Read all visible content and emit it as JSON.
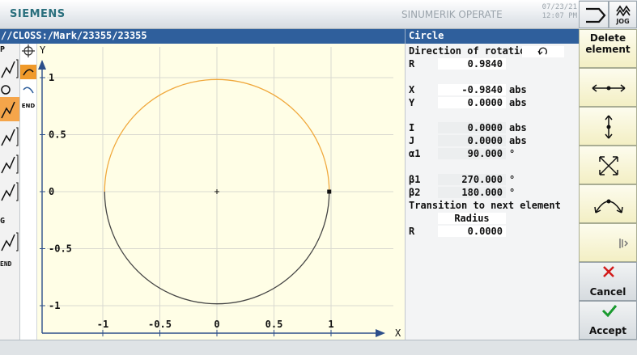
{
  "header": {
    "brand": "SIEMENS",
    "app": "SINUMERIK OPERATE",
    "date": "07/23/21",
    "time": "12:07 PM",
    "jog_label": "JOG"
  },
  "path_title": "//CLOSS:/Mark/23355/23355",
  "form": {
    "title": "Circle",
    "direction_label": "Direction of rotation",
    "r_label": "R",
    "r_value": "0.9840",
    "x_label": "X",
    "x_value": "-0.9840",
    "x_unit": "abs",
    "y_label": "Y",
    "y_value": "0.0000",
    "y_unit": "abs",
    "i_label": "I",
    "i_value": "0.0000",
    "i_unit": "abs",
    "j_label": "J",
    "j_value": "0.0000",
    "j_unit": "abs",
    "a1_label": "α1",
    "a1_value": "90.000",
    "a1_unit": "°",
    "b1_label": "β1",
    "b1_value": "270.000",
    "b1_unit": "°",
    "b2_label": "β2",
    "b2_value": "180.000",
    "b2_unit": "°",
    "transition_label": "Transition to next element",
    "transition_type": "Radius",
    "r2_label": "R",
    "r2_value": "0.0000"
  },
  "tree": {
    "labels": [
      "P",
      "G",
      "END"
    ]
  },
  "tools": {
    "end_label": "END"
  },
  "graph": {
    "y_axis_label": "Y",
    "x_axis_label": "X",
    "x_ticks": [
      "-1",
      "-0.5",
      "0",
      "0.5",
      "1"
    ],
    "y_ticks": [
      "1",
      "0.5",
      "0",
      "-0.5",
      "-1"
    ],
    "x_tick_values": [
      -1,
      -0.5,
      0,
      0.5,
      1
    ],
    "y_tick_values": [
      1,
      0.5,
      0,
      -0.5,
      -1
    ],
    "circle_radius": 0.984,
    "colors": {
      "active_arc": "#f0a83c",
      "contour": "#444444",
      "grid": "#d9d9d0"
    }
  },
  "softkeys": {
    "delete_line1": "Delete",
    "delete_line2": "element",
    "cancel": "Cancel",
    "accept": "Accept"
  }
}
